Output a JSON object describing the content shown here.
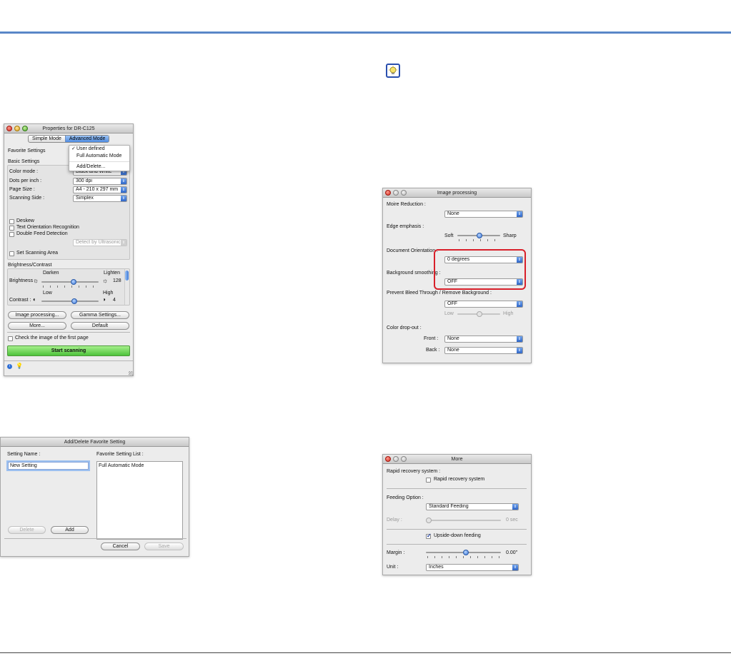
{
  "properties_window": {
    "title": "Properties for DR-C125",
    "tabs": [
      "Simple Mode",
      "Advanced Mode"
    ],
    "favorite_settings_label": "Favorite Settings",
    "favorite_menu": [
      "User defined",
      "Full Automatic Mode",
      "Add/Delete..."
    ],
    "basic_settings_label": "Basic Settings",
    "color_mode_label": "Color mode :",
    "color_mode_value": "Black and White",
    "dpi_label": "Dots per inch :",
    "dpi_value": "300 dpi",
    "page_size_label": "Page Size :",
    "page_size_value": "A4 - 210 x 297 mm",
    "scanning_side_label": "Scanning Side :",
    "scanning_side_value": "Simplex",
    "deskew_label": "Deskew",
    "text_orientation_label": "Text Orientation Recognition",
    "double_feed_label": "Double Feed Detection",
    "detect_ultrasonic_value": "Detect by Ultrasonic",
    "set_scanning_area_label": "Set Scanning Area",
    "brightness_contrast_label": "Brightness/Contrast",
    "darken_label": "Darken",
    "lighten_label": "Lighten",
    "brightness_label": "Brightness :",
    "brightness_value": "128",
    "low_label": "Low",
    "high_label": "High",
    "contrast_label": "Contrast :",
    "contrast_value": "4",
    "image_processing_button": "Image processing...",
    "gamma_button": "Gamma Settings...",
    "more_button": "More...",
    "default_button": "Default",
    "check_first_page_label": "Check the image of the first page",
    "start_scanning_button": "Start scanning"
  },
  "add_delete_window": {
    "title": "Add/Delete Favorite Setting",
    "setting_name_label": "Setting Name :",
    "setting_name_value": "New Setting",
    "favorite_list_label": "Favorite Setting List :",
    "favorite_list_items": [
      "Full Automatic Mode"
    ],
    "delete_button": "Delete",
    "add_button": "Add",
    "cancel_button": "Cancel",
    "save_button": "Save"
  },
  "image_processing_window": {
    "title": "Image processing",
    "moire_label": "Moire Reduction :",
    "moire_value": "None",
    "edge_label": "Edge emphasis :",
    "soft_label": "Soft",
    "sharp_label": "Sharp",
    "doc_orientation_label": "Document Orientation :",
    "doc_orientation_value": "0 degrees",
    "bg_smoothing_label": "Background smoothing :",
    "bg_smoothing_value": "OFF",
    "bleed_label": "Prevent Bleed Through / Remove Background :",
    "bleed_value": "OFF",
    "low_label": "Low",
    "high_label": "High",
    "color_dropout_label": "Color drop-out :",
    "front_label": "Front :",
    "front_value": "None",
    "back_label": "Back :",
    "back_value": "None"
  },
  "more_window": {
    "title": "More",
    "rapid_recovery_label": "Rapid recovery system :",
    "rapid_recovery_check": "Rapid recovery system",
    "feeding_option_label": "Feeding Option :",
    "feeding_value": "Standard Feeding",
    "delay_label": "Delay :",
    "delay_value": "0 sec",
    "upside_down_label": "Upside-down feeding",
    "margin_label": "Margin :",
    "margin_value": "0.00\"",
    "unit_label": "Unit :",
    "unit_value": "Inches"
  },
  "colors": {
    "accent_blue": "#3a6cb8",
    "highlight_red": "#d8202a",
    "start_green": "#4dc23a"
  }
}
